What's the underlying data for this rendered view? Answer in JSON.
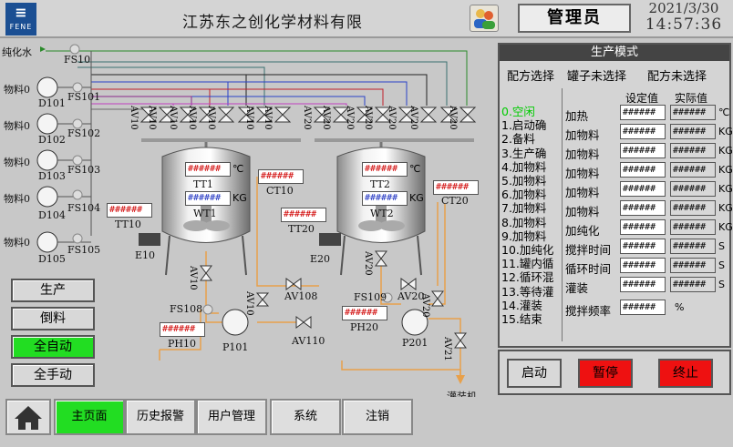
{
  "header": {
    "logo_text": "FENE",
    "company": "江苏东之创化学材料有限",
    "role": "管理员",
    "date": "2021/3/30",
    "time": "14:57:36"
  },
  "diagram": {
    "inlet_labels": [
      "纯化水",
      "物料0",
      "物料0",
      "物料0",
      "物料0",
      "物料0"
    ],
    "pump_labels": [
      "D101",
      "D102",
      "D103",
      "D104",
      "D105"
    ],
    "fs_labels": [
      "FS10",
      "FS101",
      "FS102",
      "FS103",
      "FS104",
      "FS105",
      "FS108",
      "FS109"
    ],
    "valves_top": [
      "AV10",
      "AV10",
      "AV10",
      "AV10",
      "AV10",
      "AV10",
      "AV10",
      "AV20",
      "AV20",
      "AV20",
      "AV20",
      "AV20",
      "AV20",
      "AV20"
    ],
    "tank1": {
      "temp": "######",
      "temp_unit": "℃",
      "tt": "TT1",
      "weight": "######",
      "weight_unit": "KG",
      "wt": "WT1"
    },
    "tank2": {
      "temp": "######",
      "temp_unit": "℃",
      "tt": "TT2",
      "weight": "######",
      "weight_unit": "KG",
      "wt": "WT2"
    },
    "ct101_value": "######",
    "ct101": "CT10",
    "tt101_value": "######",
    "tt101": "TT10",
    "tt201_value": "######",
    "tt201": "TT20",
    "ct201_value": "######",
    "ct201": "CT20",
    "ph101_value": "######",
    "ph101": "PH10",
    "ph201_value": "######",
    "ph201": "PH20",
    "e101": "E10",
    "e201": "E20",
    "p101": "P101",
    "p201": "P201",
    "av_labels": {
      "av110": "AV110",
      "av108": "AV108",
      "av107": "AV10",
      "av109": "AV10",
      "av208": "AV20",
      "av207": "AV20",
      "av209": "AV20",
      "av210": "AV21",
      "av201": "AV20"
    },
    "filling": "灌装机"
  },
  "modes": [
    "生产",
    "倒料",
    "全自动",
    "全手动"
  ],
  "active_mode": "全自动",
  "panel": {
    "title": "生产模式",
    "recipe_select": "配方选择",
    "tank_unselected": "罐子未选择",
    "recipe_unselected": "配方未选择",
    "set_header": "设定值",
    "actual_header": "实际值",
    "steps": [
      "0.空闲",
      "1.启动确",
      "2.备料",
      "3.生产确",
      "4.加物料",
      "5.加物料",
      "6.加物料",
      "7.加物料",
      "8.加物料",
      "9.加物料",
      "10.加纯化",
      "11.罐内循",
      "12.循环混",
      "13.等待灌",
      "14.灌装",
      "15.结束"
    ],
    "params": [
      {
        "label": "加热",
        "set": "######",
        "act": "######",
        "unit": "℃"
      },
      {
        "label": "加物料",
        "set": "######",
        "act": "######",
        "unit": "KG"
      },
      {
        "label": "加物料",
        "set": "######",
        "act": "######",
        "unit": "KG"
      },
      {
        "label": "加物料",
        "set": "######",
        "act": "######",
        "unit": "KG"
      },
      {
        "label": "加物料",
        "set": "######",
        "act": "######",
        "unit": "KG"
      },
      {
        "label": "加物料",
        "set": "######",
        "act": "######",
        "unit": "KG"
      },
      {
        "label": "加纯化",
        "set": "######",
        "act": "######",
        "unit": "KG"
      },
      {
        "label": "搅拌时间",
        "set": "######",
        "act": "######",
        "unit": "S"
      },
      {
        "label": "循环时间",
        "set": "######",
        "act": "######",
        "unit": "S"
      },
      {
        "label": "灌装",
        "set": "######",
        "act": "######",
        "unit": "S"
      },
      {
        "label": "搅拌频率",
        "set": "######",
        "act": "",
        "unit": "%"
      }
    ]
  },
  "actions": {
    "start": "启动",
    "pause": "暂停",
    "stop": "终止",
    "pause_color": "#ee1111",
    "stop_color": "#ee1111"
  },
  "nav": [
    "主页面",
    "历史报警",
    "用户管理",
    "系统",
    "注销"
  ],
  "active_nav": "主页面"
}
